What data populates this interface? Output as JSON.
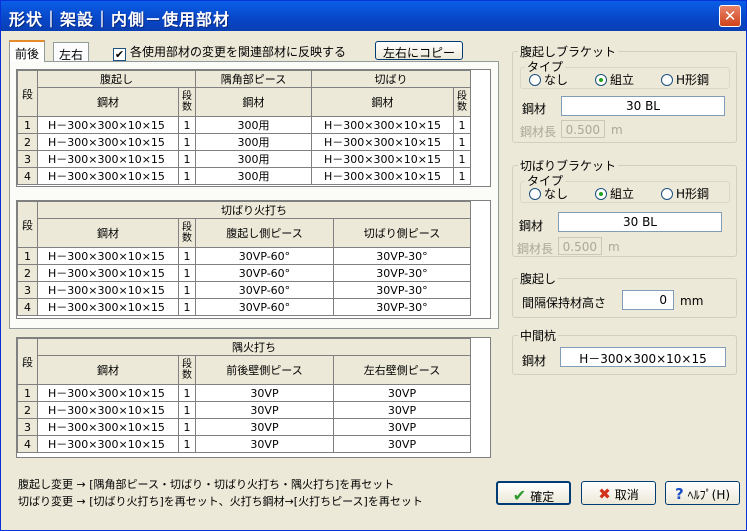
{
  "window": {
    "title": "形状｜架設｜内側－使用部材",
    "close_glyph": "✕"
  },
  "tabs": [
    "前後",
    "左右"
  ],
  "reflect_checkbox": {
    "label": "各使用部材の変更を関連部材に反映する",
    "checked_glyph": "✔"
  },
  "copy_button": "左右にコピー",
  "table1": {
    "row_header": "段",
    "groups": [
      "腹起し",
      "隅角部ピース",
      "切ばり"
    ],
    "columns": [
      "鋼材",
      "段数",
      "鋼材",
      "鋼材",
      "段数"
    ],
    "rows": [
      [
        "1",
        "H－300×300×10×15",
        "1",
        "300用",
        "H－300×300×10×15",
        "1"
      ],
      [
        "2",
        "H－300×300×10×15",
        "1",
        "300用",
        "H－300×300×10×15",
        "1"
      ],
      [
        "3",
        "H－300×300×10×15",
        "1",
        "300用",
        "H－300×300×10×15",
        "1"
      ],
      [
        "4",
        "H－300×300×10×15",
        "1",
        "300用",
        "H－300×300×10×15",
        "1"
      ]
    ]
  },
  "table2": {
    "row_header": "段",
    "group": "切ばり火打ち",
    "columns": [
      "鋼材",
      "段数",
      "腹起し側ピース",
      "切ばり側ピース"
    ],
    "rows": [
      [
        "1",
        "H－300×300×10×15",
        "1",
        "30VP-60°",
        "30VP-30°"
      ],
      [
        "2",
        "H－300×300×10×15",
        "1",
        "30VP-60°",
        "30VP-30°"
      ],
      [
        "3",
        "H－300×300×10×15",
        "1",
        "30VP-60°",
        "30VP-30°"
      ],
      [
        "4",
        "H－300×300×10×15",
        "1",
        "30VP-60°",
        "30VP-30°"
      ]
    ]
  },
  "table3": {
    "row_header": "段",
    "group": "隅火打ち",
    "columns": [
      "鋼材",
      "段数",
      "前後壁側ピース",
      "左右壁側ピース"
    ],
    "rows": [
      [
        "1",
        "H－300×300×10×15",
        "1",
        "30VP",
        "30VP"
      ],
      [
        "2",
        "H－300×300×10×15",
        "1",
        "30VP",
        "30VP"
      ],
      [
        "3",
        "H－300×300×10×15",
        "1",
        "30VP",
        "30VP"
      ],
      [
        "4",
        "H－300×300×10×15",
        "1",
        "30VP",
        "30VP"
      ]
    ]
  },
  "haraokoshi_bracket": {
    "title": "腹起しブラケット",
    "type_title": "タイプ",
    "options": [
      "なし",
      "組立",
      "H形鋼"
    ],
    "selected": 1,
    "steel_label": "鋼材",
    "steel_value": "30 BL",
    "length_label": "鋼材長",
    "length_value": "0.500",
    "length_unit": "m"
  },
  "kiribari_bracket": {
    "title": "切ばりブラケット",
    "type_title": "タイプ",
    "options": [
      "なし",
      "組立",
      "H形鋼"
    ],
    "selected": 1,
    "steel_label": "鋼材",
    "steel_value": "30 BL",
    "length_label": "鋼材長",
    "length_value": "0.500",
    "length_unit": "m"
  },
  "haraokoshi": {
    "title": "腹起し",
    "spacer_label": "間隔保持材高さ",
    "spacer_value": "0",
    "spacer_unit": "mm"
  },
  "middle_pile": {
    "title": "中間杭",
    "steel_label": "鋼材",
    "steel_value": "H－300×300×10×15"
  },
  "notes": [
    "腹起し変更 → [隅角部ピース・切ばり・切ばり火打ち・隅火打ち]を再セット",
    "切ばり変更 → [切ばり火打ち]を再セット、火打ち鋼材→[火打ちピース]を再セット"
  ],
  "buttons": {
    "ok": "確定",
    "cancel": "取消",
    "help": "ﾍﾙﾌﾟ(H)"
  },
  "icons": {
    "ok": "✔",
    "cancel": "✖",
    "help": "?"
  },
  "colors": {
    "ok_icon": "#2e9a2e",
    "cancel_icon": "#d0311b",
    "help_icon": "#1a4fc4",
    "title_bar": "#0a5ee8"
  }
}
